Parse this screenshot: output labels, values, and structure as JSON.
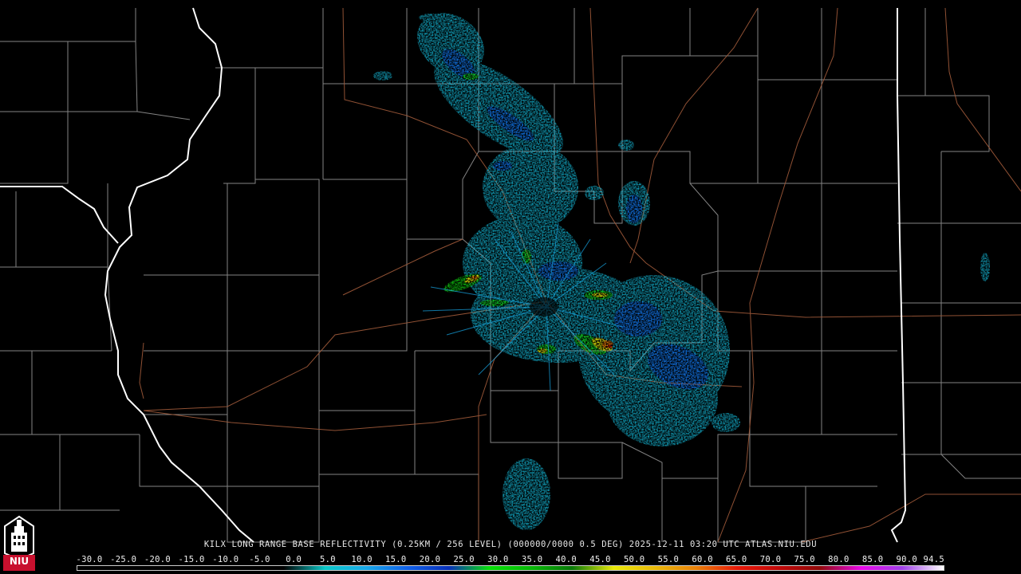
{
  "caption": "KILX LONG RANGE BASE REFLECTIVITY (0.25KM / 256 LEVEL) (000000/0000 0.5 DEG) 2025-12-11 03:20 UTC  ATLAS.NIU.EDU",
  "logo_text": "NIU",
  "legend": {
    "ticks": [
      "-30.0",
      "-25.0",
      "-20.0",
      "-15.0",
      "-10.0",
      "-5.0",
      "0.0",
      "5.0",
      "10.0",
      "15.0",
      "20.0",
      "25.0",
      "30.0",
      "35.0",
      "40.0",
      "45.0",
      "50.0",
      "55.0",
      "60.0",
      "65.0",
      "70.0",
      "75.0",
      "80.0",
      "85.0",
      "90.0",
      "94.5"
    ],
    "colors": [
      "#000000",
      "#000000",
      "#000000",
      "#000000",
      "#000000",
      "#000000",
      "#0bc8c8",
      "#18a8e8",
      "#1060e8",
      "#0830b8",
      "#08e008",
      "#08b808",
      "#087808",
      "#e8e808",
      "#e8b808",
      "#e88008",
      "#e81808",
      "#c00808",
      "#900808",
      "#e808e8",
      "#a040e8",
      "#ffffff"
    ],
    "colors_note": "0..75 dBZ bins"
  },
  "colors": {
    "background": "#000000",
    "county_border": "#9a9a9a",
    "state_border": "#ffffff",
    "highway": "#a05a3a"
  }
}
